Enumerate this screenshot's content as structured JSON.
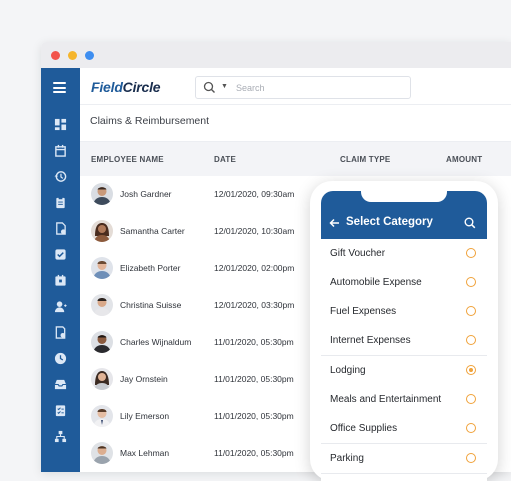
{
  "app": {
    "logo_part1": "Field",
    "logo_part2": "Circle",
    "search_placeholder": "Search",
    "brand_color": "#1f5b9a",
    "accent_color": "#f0a23a"
  },
  "sidebar": {
    "icons": [
      "menu-icon",
      "dashboard-icon",
      "calendar-icon",
      "history-icon",
      "clipboard-icon",
      "document-icon",
      "checkbox-icon",
      "schedule-icon",
      "user-icon",
      "settings-doc-icon",
      "clock-icon",
      "inbox-icon",
      "checklist-icon",
      "hierarchy-icon"
    ]
  },
  "page": {
    "title": "Claims & Reimbursement"
  },
  "table": {
    "columns": [
      "EMPLOYEE NAME",
      "DATE",
      "CLAIM TYPE",
      "AMOUNT"
    ],
    "rows": [
      {
        "name": "Josh Gardner",
        "date": "12/01/2020, 09:30am"
      },
      {
        "name": "Samantha Carter",
        "date": "12/01/2020, 10:30am"
      },
      {
        "name": "Elizabeth Porter",
        "date": "12/01/2020, 02:00pm"
      },
      {
        "name": "Christina Suisse",
        "date": "12/01/2020, 03:30pm"
      },
      {
        "name": "Charles Wijnaldum",
        "date": "11/01/2020, 05:30pm"
      },
      {
        "name": "Jay Ornstein",
        "date": "11/01/2020, 05:30pm"
      },
      {
        "name": "Lily Emerson",
        "date": "11/01/2020, 05:30pm"
      },
      {
        "name": "Max Lehman",
        "date": "11/01/2020, 05:30pm"
      }
    ]
  },
  "phone": {
    "title": "Select Category",
    "categories": [
      {
        "label": "Gift Voucher",
        "selected": false
      },
      {
        "label": "Automobile Expense",
        "selected": false
      },
      {
        "label": "Fuel Expenses",
        "selected": false
      },
      {
        "label": "Internet Expenses",
        "selected": false
      },
      {
        "label": "Lodging",
        "selected": true
      },
      {
        "label": "Meals and Entertainment",
        "selected": false
      },
      {
        "label": "Office Supplies",
        "selected": false
      },
      {
        "label": "Parking",
        "selected": false
      }
    ]
  }
}
